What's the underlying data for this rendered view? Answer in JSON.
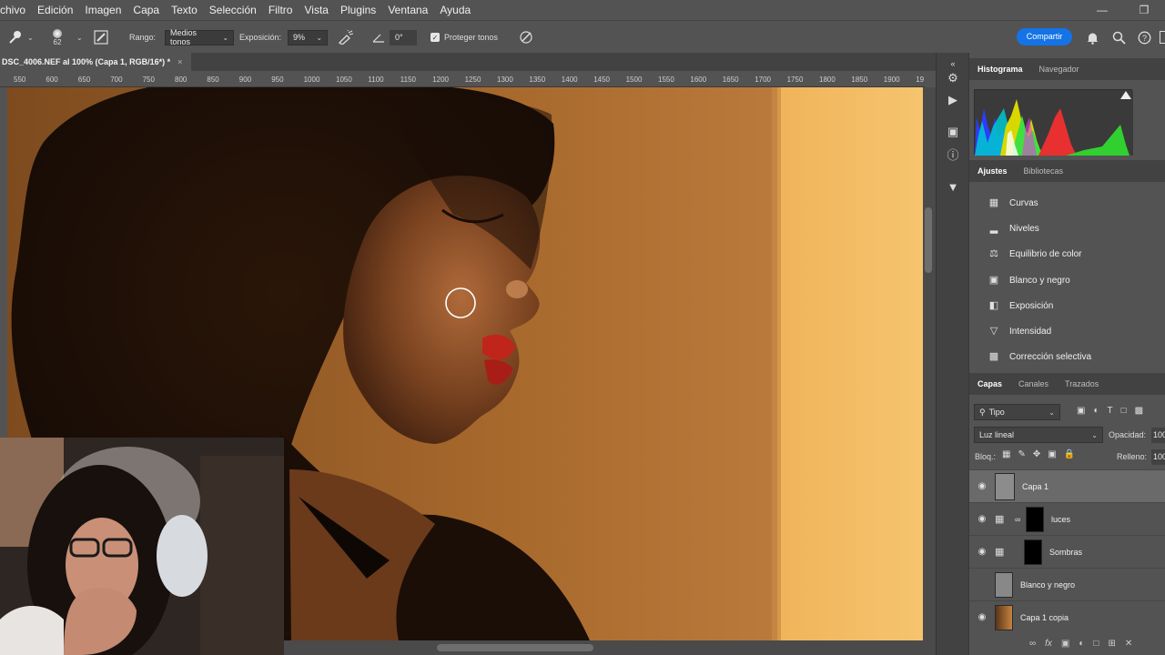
{
  "menu": [
    "chivo",
    "Edición",
    "Imagen",
    "Capa",
    "Texto",
    "Selección",
    "Filtro",
    "Vista",
    "Plugins",
    "Ventana",
    "Ayuda"
  ],
  "options": {
    "brush_size": "62",
    "range_label": "Rango:",
    "range_value": "Medios tonos",
    "exposure_label": "Exposición:",
    "exposure_value": "9%",
    "angle_value": "0°",
    "protect_label": "Proteger tonos",
    "share_label": "Compartir"
  },
  "document": {
    "tab_title": "DSC_4006.NEF al 100% (Capa 1, RGB/16*) *",
    "close": "×",
    "ruler_ticks": [
      "550",
      "600",
      "650",
      "700",
      "750",
      "800",
      "850",
      "900",
      "950",
      "1000",
      "1050",
      "1100",
      "1150",
      "1200",
      "1250",
      "1300",
      "1350",
      "1400",
      "1450",
      "1500",
      "1550",
      "1600",
      "1650",
      "1700",
      "1750",
      "1800",
      "1850",
      "1900",
      "19"
    ]
  },
  "panels": {
    "top_tabs": [
      "Histograma",
      "Navegador"
    ],
    "adjust_tabs": [
      "Ajustes",
      "Bibliotecas"
    ],
    "adjustments": [
      {
        "label": "Curvas",
        "icon": "curves-icon"
      },
      {
        "label": "Niveles",
        "icon": "levels-icon"
      },
      {
        "label": "Equilibrio de color",
        "icon": "color-balance-icon"
      },
      {
        "label": "Blanco y negro",
        "icon": "black-white-icon"
      },
      {
        "label": "Exposición",
        "icon": "exposure-icon"
      },
      {
        "label": "Intensidad",
        "icon": "vibrance-icon"
      },
      {
        "label": "Corrección selectiva",
        "icon": "selective-color-icon"
      }
    ],
    "layer_tabs": [
      "Capas",
      "Canales",
      "Trazados"
    ],
    "filter_label": "Tipo",
    "blend_mode": "Luz lineal",
    "opacity_label": "Opacidad:",
    "opacity_value": "100",
    "lock_label": "Bloq.:",
    "fill_label": "Relleno:",
    "fill_value": "100",
    "layers": [
      {
        "name": "Capa 1",
        "visible": true,
        "selected": true
      },
      {
        "name": "luces",
        "visible": true,
        "selected": false
      },
      {
        "name": "Sombras",
        "visible": true,
        "selected": false
      },
      {
        "name": "Blanco y negro",
        "visible": false,
        "selected": false
      },
      {
        "name": "Capa 1 copia",
        "visible": true,
        "selected": false
      }
    ]
  },
  "colors": {
    "accent": "#1473e6",
    "panel_bg": "#535353",
    "dark_bg": "#424242"
  }
}
